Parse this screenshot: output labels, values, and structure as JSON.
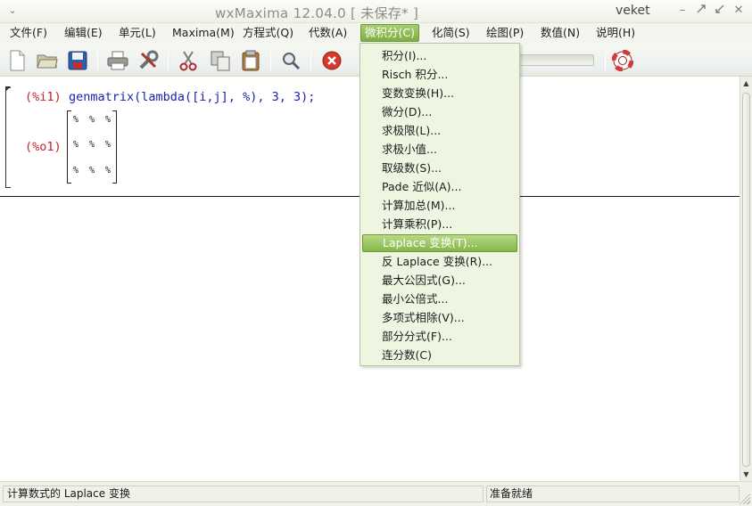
{
  "window": {
    "title": "wxMaxima 12.04.0 [ 未保存* ]",
    "user": "veket",
    "sysmenu_icon": "chevron-down-icon",
    "controls": [
      "minimize-icon",
      "restore-icon",
      "close-icon"
    ]
  },
  "menubar": {
    "items": [
      "文件(F)",
      "编辑(E)",
      "单元(L)",
      "Maxima(M)",
      "方程式(Q)",
      "代数(A)",
      "微积分(C)",
      "化简(S)",
      "绘图(P)",
      "数值(N)",
      "说明(H)"
    ],
    "active": "微积分(C)"
  },
  "toolbar": {
    "icons": [
      "new-document-icon",
      "open-folder-icon",
      "save-icon",
      "print-icon",
      "preferences-icon",
      "cut-icon",
      "copy-icon",
      "paste-icon",
      "search-icon",
      "stop-icon",
      "help-lifebuoy-icon"
    ]
  },
  "document": {
    "input_label": "(%i1)",
    "input_code": "genmatrix(lambda([i,j], %), 3, 3);",
    "output_label": "(%o1)",
    "matrix": [
      [
        "%",
        "%",
        "%"
      ],
      [
        "%",
        "%",
        "%"
      ],
      [
        "%",
        "%",
        "%"
      ]
    ]
  },
  "dropdown": {
    "items": [
      "积分(I)...",
      "Risch 积分...",
      "变数变换(H)...",
      "微分(D)...",
      "求极限(L)...",
      "求极小值...",
      "取级数(S)...",
      "Pade 近似(A)...",
      "计算加总(M)...",
      "计算乘积(P)...",
      "Laplace 变换(T)...",
      "反 Laplace 变换(R)...",
      "最大公因式(G)...",
      "最小公倍式...",
      "多项式相除(V)...",
      "部分分式(F)...",
      "连分数(C)"
    ],
    "highlighted": "Laplace 变换(T)..."
  },
  "statusbar": {
    "left": "计算数式的 Laplace 变换",
    "right": "准备就绪"
  },
  "colors": {
    "accent": "#86b64b",
    "input_label": "#c8232b",
    "input_code": "#1a1fa8"
  }
}
